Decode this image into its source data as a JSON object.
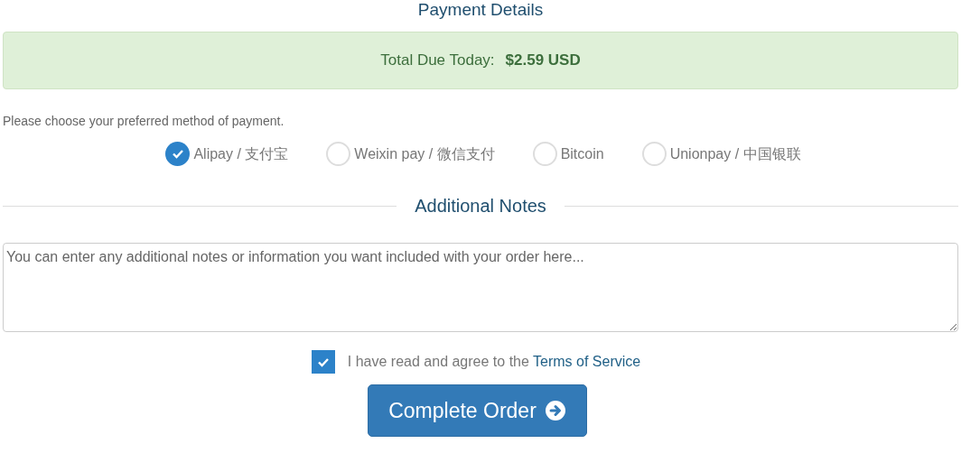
{
  "section_title": "Payment Details",
  "total": {
    "label": "Total Due Today:",
    "amount": "$2.59 USD"
  },
  "payment_prompt": "Please choose your preferred method of payment.",
  "payment_methods": [
    {
      "label": "Alipay / 支付宝",
      "selected": true
    },
    {
      "label": "Weixin pay / 微信支付",
      "selected": false
    },
    {
      "label": "Bitcoin",
      "selected": false
    },
    {
      "label": "Unionpay / 中国银联",
      "selected": false
    }
  ],
  "notes": {
    "title": "Additional Notes",
    "placeholder": "You can enter any additional notes or information you want included with your order here..."
  },
  "terms": {
    "checked": true,
    "text": "I have read and agree to the",
    "link": "Terms of Service"
  },
  "submit": {
    "label": "Complete Order"
  }
}
